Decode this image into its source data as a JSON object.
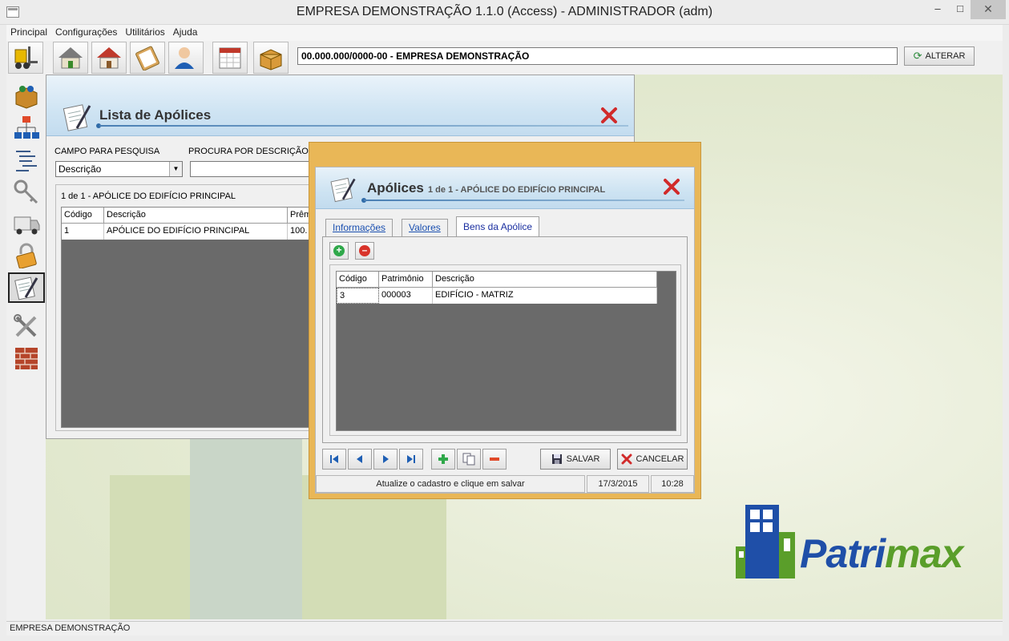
{
  "window": {
    "title": "EMPRESA DEMONSTRAÇÃO 1.1.0 (Access) - ADMINISTRADOR (adm)"
  },
  "menu": [
    "Principal",
    "Configurações",
    "Utilitários",
    "Ajuda"
  ],
  "toolbar": {
    "icons": [
      "forklift-icon",
      "house-icon",
      "home-icon",
      "clipboard-icon",
      "user-icon",
      "calendar-icon",
      "box-icon"
    ],
    "company": "00.000.000/0000-00 - EMPRESA DEMONSTRAÇÃO",
    "alterar_label": "ALTERAR"
  },
  "sidebar": {
    "icons": [
      "package-icon",
      "org-chart-icon",
      "tree-list-icon",
      "keys-icon",
      "truck-icon",
      "lock-icon",
      "document-pen-icon",
      "tools-icon",
      "bricks-icon"
    ],
    "active_index": 6
  },
  "lista": {
    "title": "Lista de Apólices",
    "campo_label": "CAMPO PARA PESQUISA",
    "campo_value": "Descrição",
    "procura_label": "PROCURA POR DESCRIÇÃO:",
    "count_label": "1 de 1 - APÓLICE DO EDIFÍCIO PRINCIPAL",
    "columns": [
      "Código",
      "Descrição",
      "Prêm"
    ],
    "rows": [
      [
        "1",
        "APÓLICE DO EDIFÍCIO PRINCIPAL",
        "100."
      ]
    ]
  },
  "dialog": {
    "title": "Apólices",
    "subtitle": "1 de 1 - APÓLICE DO EDIFÍCIO PRINCIPAL",
    "tabs": [
      "Informações",
      "Valores",
      "Bens da Apólice"
    ],
    "active_tab": 2,
    "columns": [
      "Código",
      "Patrimônio",
      "Descrição"
    ],
    "rows": [
      [
        "3",
        "000003",
        "EDIFÍCIO - MATRIZ"
      ]
    ],
    "salvar_label": "SALVAR",
    "cancelar_label": "CANCELAR",
    "status_message": "Atualize o cadastro e clique em salvar",
    "status_date": "17/3/2015",
    "status_time": "10:28"
  },
  "logo": {
    "text_a": "Patri",
    "text_b": "max"
  },
  "app_status": "EMPRESA DEMONSTRAÇÃO",
  "colors": {
    "dialog_border": "#e9b757",
    "header_blue": "#cde3f2",
    "grid_bg": "#6a6a6a",
    "logo_blue": "#1f4fa8",
    "logo_green": "#5a9e2a"
  }
}
